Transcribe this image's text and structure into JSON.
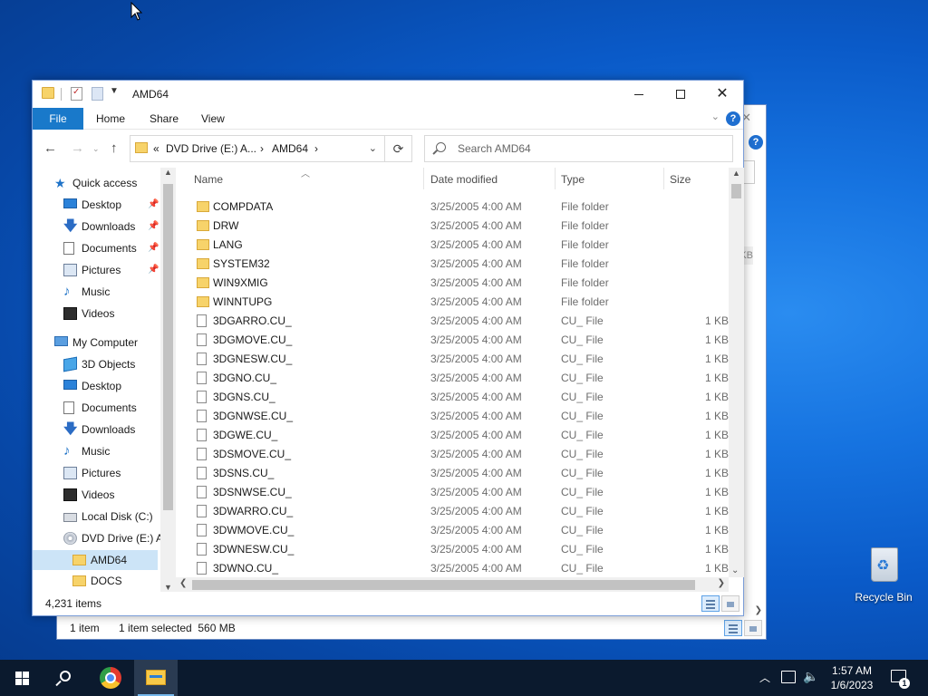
{
  "desktop": {
    "recycle_bin_label": "Recycle Bin"
  },
  "back_window": {
    "status_items": "1 item",
    "status_selected": "1 item selected  560 MB",
    "size_fragment": "KB"
  },
  "window": {
    "title": "AMD64",
    "ribbon_tabs": {
      "file": "File",
      "home": "Home",
      "share": "Share",
      "view": "View"
    },
    "address": {
      "overflow": "«",
      "segment1": "DVD Drive (E:) A...",
      "separator": "›",
      "segment2": "AMD64",
      "separator2": "›"
    },
    "search": {
      "placeholder": "Search AMD64"
    },
    "columns": {
      "name": "Name",
      "date": "Date modified",
      "type": "Type",
      "size": "Size"
    },
    "nav_items": [
      {
        "label": "Quick access",
        "icon": "star-icon"
      },
      {
        "label": "Desktop",
        "icon": "desktop-icon",
        "pinned": true
      },
      {
        "label": "Downloads",
        "icon": "downloads-icon",
        "pinned": true
      },
      {
        "label": "Documents",
        "icon": "documents-icon",
        "pinned": true
      },
      {
        "label": "Pictures",
        "icon": "pictures-icon",
        "pinned": true
      },
      {
        "label": "Music",
        "icon": "music-icon"
      },
      {
        "label": "Videos",
        "icon": "videos-icon"
      },
      {
        "label": "My Computer",
        "icon": "computer-icon"
      },
      {
        "label": "3D Objects",
        "icon": "3d-objects-icon"
      },
      {
        "label": "Desktop",
        "icon": "desktop-icon"
      },
      {
        "label": "Documents",
        "icon": "documents-icon"
      },
      {
        "label": "Downloads",
        "icon": "downloads-icon"
      },
      {
        "label": "Music",
        "icon": "music-icon"
      },
      {
        "label": "Pictures",
        "icon": "pictures-icon"
      },
      {
        "label": "Videos",
        "icon": "videos-icon"
      },
      {
        "label": "Local Disk (C:)",
        "icon": "local-disk-icon"
      },
      {
        "label": "DVD Drive (E:) Al",
        "icon": "dvd-drive-icon"
      },
      {
        "label": "AMD64",
        "icon": "folder-icon",
        "selected": true
      },
      {
        "label": "DOCS",
        "icon": "folder-icon"
      }
    ],
    "files": [
      {
        "name": "COMPDATA",
        "date": "3/25/2005 4:00 AM",
        "type": "File folder",
        "size": "",
        "folder": true
      },
      {
        "name": "DRW",
        "date": "3/25/2005 4:00 AM",
        "type": "File folder",
        "size": "",
        "folder": true
      },
      {
        "name": "LANG",
        "date": "3/25/2005 4:00 AM",
        "type": "File folder",
        "size": "",
        "folder": true
      },
      {
        "name": "SYSTEM32",
        "date": "3/25/2005 4:00 AM",
        "type": "File folder",
        "size": "",
        "folder": true
      },
      {
        "name": "WIN9XMIG",
        "date": "3/25/2005 4:00 AM",
        "type": "File folder",
        "size": "",
        "folder": true
      },
      {
        "name": "WINNTUPG",
        "date": "3/25/2005 4:00 AM",
        "type": "File folder",
        "size": "",
        "folder": true
      },
      {
        "name": "3DGARRO.CU_",
        "date": "3/25/2005 4:00 AM",
        "type": "CU_ File",
        "size": "1 KB",
        "folder": false
      },
      {
        "name": "3DGMOVE.CU_",
        "date": "3/25/2005 4:00 AM",
        "type": "CU_ File",
        "size": "1 KB",
        "folder": false
      },
      {
        "name": "3DGNESW.CU_",
        "date": "3/25/2005 4:00 AM",
        "type": "CU_ File",
        "size": "1 KB",
        "folder": false
      },
      {
        "name": "3DGNO.CU_",
        "date": "3/25/2005 4:00 AM",
        "type": "CU_ File",
        "size": "1 KB",
        "folder": false
      },
      {
        "name": "3DGNS.CU_",
        "date": "3/25/2005 4:00 AM",
        "type": "CU_ File",
        "size": "1 KB",
        "folder": false
      },
      {
        "name": "3DGNWSE.CU_",
        "date": "3/25/2005 4:00 AM",
        "type": "CU_ File",
        "size": "1 KB",
        "folder": false
      },
      {
        "name": "3DGWE.CU_",
        "date": "3/25/2005 4:00 AM",
        "type": "CU_ File",
        "size": "1 KB",
        "folder": false
      },
      {
        "name": "3DSMOVE.CU_",
        "date": "3/25/2005 4:00 AM",
        "type": "CU_ File",
        "size": "1 KB",
        "folder": false
      },
      {
        "name": "3DSNS.CU_",
        "date": "3/25/2005 4:00 AM",
        "type": "CU_ File",
        "size": "1 KB",
        "folder": false
      },
      {
        "name": "3DSNWSE.CU_",
        "date": "3/25/2005 4:00 AM",
        "type": "CU_ File",
        "size": "1 KB",
        "folder": false
      },
      {
        "name": "3DWARRO.CU_",
        "date": "3/25/2005 4:00 AM",
        "type": "CU_ File",
        "size": "1 KB",
        "folder": false
      },
      {
        "name": "3DWMOVE.CU_",
        "date": "3/25/2005 4:00 AM",
        "type": "CU_ File",
        "size": "1 KB",
        "folder": false
      },
      {
        "name": "3DWNESW.CU_",
        "date": "3/25/2005 4:00 AM",
        "type": "CU_ File",
        "size": "1 KB",
        "folder": false
      },
      {
        "name": "3DWNO.CU_",
        "date": "3/25/2005 4:00 AM",
        "type": "CU_ File",
        "size": "1 KB",
        "folder": false
      }
    ],
    "status_count": "4,231 items"
  },
  "taskbar": {
    "time": "1:57 AM",
    "date": "1/6/2023",
    "notification_count": "1"
  }
}
